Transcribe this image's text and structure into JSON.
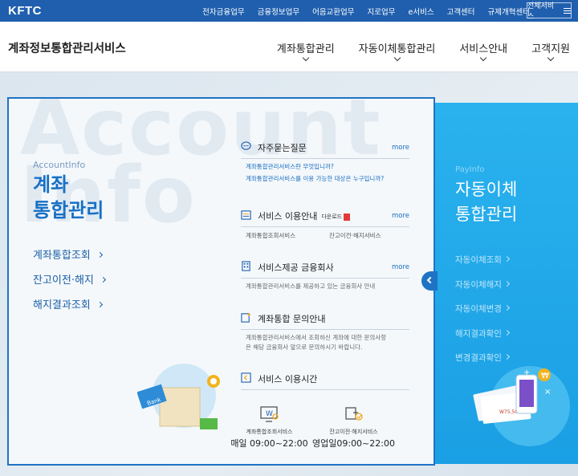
{
  "topbar": {
    "logo": "KFTC",
    "links": [
      "전자금융업무",
      "금융정보업무",
      "어음교환업무",
      "지로업무",
      "e서비스",
      "고객센터",
      "규제개혁센터"
    ],
    "all_services": "전체서비스",
    "bg_color": "#1f5fae"
  },
  "header": {
    "site_title": "계좌정보통합관리서비스",
    "nav": [
      "계좌통합관리",
      "자동이체통합관리",
      "서비스안내",
      "고객지원"
    ]
  },
  "account_panel": {
    "bg_word_1": "Account",
    "bg_word_2": "Info",
    "subtitle": "AccountInfo",
    "title_line1": "계좌",
    "title_line2": "통합관리",
    "links": [
      "계좌통합조회",
      "잔고이전·해지",
      "해지결과조회"
    ],
    "border_color": "#1f73c4"
  },
  "blocks": {
    "faq": {
      "title": "자주묻는질문",
      "more": "more",
      "lines": [
        "계좌통합관리서비스란 무엇입니까?",
        "계좌통합관리서비스를 이용 가능한 대상은 누구입니까?"
      ],
      "icon": "speech-bubble-icon"
    },
    "guide": {
      "title": "서비스 이용안내",
      "download": "다운로드",
      "more": "more",
      "items": [
        "계좌통합조회서비스",
        "잔고이전·해지서비스"
      ],
      "icon": "calendar-list-icon"
    },
    "institutions": {
      "title": "서비스제공 금융회사",
      "more": "more",
      "line": "계좌통합관리서비스를 제공하고 있는 금융회사 안내",
      "icon": "building-icon"
    },
    "inquiry": {
      "title": "계좌통합 문의안내",
      "lines": [
        "계좌통합관리서비스에서 조회하신 계좌에 대한 문의사항",
        "은 해당 금융회사 앞으로 문의하시기 바랍니다."
      ],
      "icon": "document-plus-icon"
    },
    "hours": {
      "title": "서비스 이용시간",
      "icon": "clock-chevron-icon",
      "items": [
        {
          "label": "계좌통합조회서비스",
          "time": "매일 09:00~22:00",
          "icon": "monitor-search-icon"
        },
        {
          "label": "잔고이전·해지서비스",
          "time": "영업일09:00~22:00",
          "icon": "transfer-check-icon"
        }
      ]
    }
  },
  "pay_panel": {
    "subtitle": "PayInfo",
    "title_line1": "자동이체",
    "title_line2": "통합관리",
    "links": [
      "자동이체조회",
      "자동이체해지",
      "자동이체변경",
      "해지결과확인",
      "변경결과확인"
    ],
    "bg_color": "#1fa8e8"
  },
  "illustration": {
    "bank_tag": "Bank",
    "amount_tag": "W75,500"
  }
}
